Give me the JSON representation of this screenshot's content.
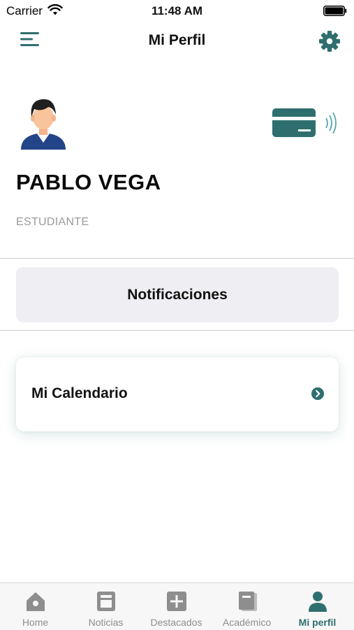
{
  "status_bar": {
    "carrier": "Carrier",
    "time": "11:48 AM"
  },
  "nav": {
    "title": "Mi Perfil",
    "menu_icon": "menu-icon",
    "settings_icon": "gear-icon"
  },
  "profile": {
    "name": "PABLO VEGA",
    "role": "ESTUDIANTE",
    "avatar_icon": "user-avatar",
    "card_icon": "contactless-card-icon"
  },
  "actions": {
    "notifications_label": "Notificaciones"
  },
  "calendar": {
    "label": "Mi Calendario"
  },
  "tabs": [
    {
      "label": "Home",
      "icon": "home-icon",
      "active": false
    },
    {
      "label": "Noticias",
      "icon": "news-icon",
      "active": false
    },
    {
      "label": "Destacados",
      "icon": "plus-square-icon",
      "active": false
    },
    {
      "label": "Académico",
      "icon": "book-icon",
      "active": false
    },
    {
      "label": "Mi perfil",
      "icon": "person-icon",
      "active": true
    }
  ],
  "colors": {
    "accent": "#2f6e6e",
    "tab_inactive": "#8e8e8e",
    "notification_bg": "#efeff3"
  }
}
